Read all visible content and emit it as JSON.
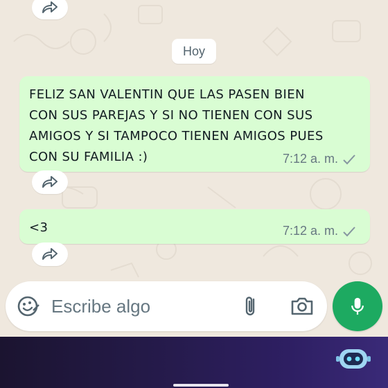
{
  "chat": {
    "date_chip": "Hoy",
    "messages": [
      {
        "text": "FELIZ SAN VALENTIN QUE LAS PASEN BIEN\nCON SUS PAREJAS Y SI NO TIENEN CON SUS\nAMIGOS Y SI TAMPOCO TIENEN AMIGOS PUES\nCON SU FAMILIA :)",
        "time": "7:12 a. m.",
        "status": "sent-single-check"
      },
      {
        "text": "<3",
        "time": "7:12 a. m.",
        "status": "sent-single-check"
      }
    ]
  },
  "composer": {
    "placeholder": "Escribe algo",
    "icons": [
      "emoji-icon",
      "paperclip-icon",
      "camera-icon",
      "microphone-icon"
    ]
  },
  "colors": {
    "outgoing_bubble": "#d9fdd3",
    "background": "#efe8de",
    "mic_button": "#1daa61",
    "meta_text": "#667781"
  }
}
